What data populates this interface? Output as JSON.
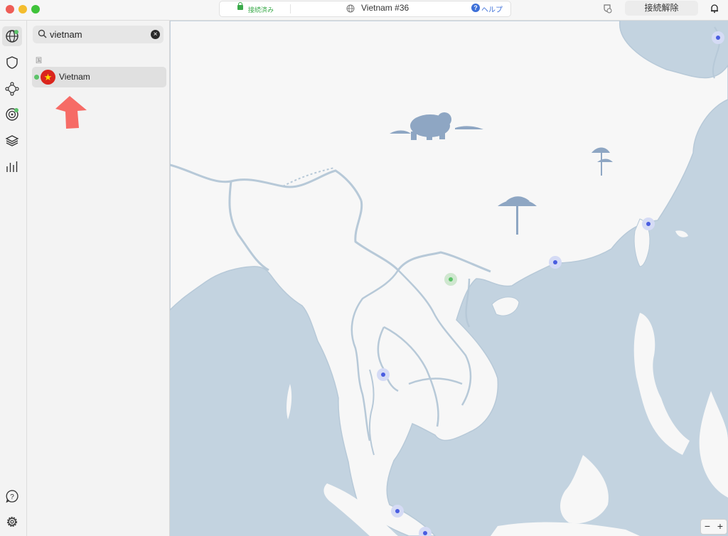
{
  "window": {
    "status": "接続済み",
    "server": "Vietnam #36",
    "help_label": "ヘルプ",
    "disconnect_label": "接続解除"
  },
  "sidebar": {
    "search_value": "vietnam",
    "section_label": "国",
    "results": [
      {
        "label": "Vietnam",
        "connected": true
      }
    ]
  },
  "rail": {
    "items": [
      "globe-icon",
      "shield-icon",
      "meshnet-icon",
      "target-icon",
      "layers-icon",
      "stats-icon",
      "help-icon",
      "settings-icon"
    ]
  },
  "map": {
    "zoom_out": "−",
    "zoom_in": "+"
  },
  "colors": {
    "sea": "#c3d3e0",
    "land": "#f7f7f7",
    "border": "#b7c9d8",
    "connected": "#5cc36a",
    "server_dot": "#4a5de0",
    "arrow": "#f66b66"
  }
}
